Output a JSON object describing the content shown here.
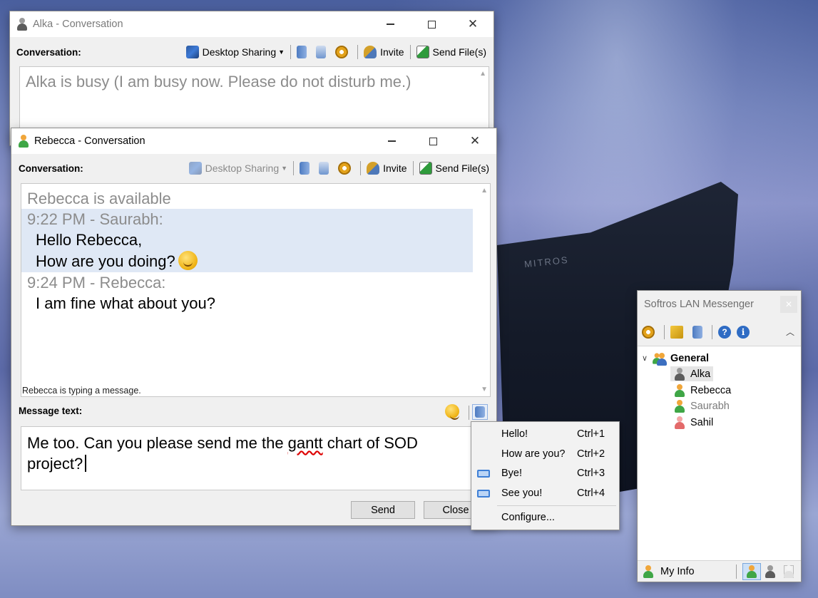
{
  "desktop": {
    "background_text": "MITROS"
  },
  "alka_window": {
    "title": "Alka - Conversation",
    "toolbar": {
      "label": "Conversation:",
      "desktop_sharing": "Desktop Sharing",
      "invite": "Invite",
      "send_files": "Send File(s)"
    },
    "status": "Alka is busy (I am busy now. Please do not disturb me.)"
  },
  "rebecca_window": {
    "title": "Rebecca - Conversation",
    "toolbar": {
      "label": "Conversation:",
      "desktop_sharing": "Desktop Sharing",
      "invite": "Invite",
      "send_files": "Send File(s)"
    },
    "status": "Rebecca is available",
    "messages": [
      {
        "header": "9:22 PM - Saurabh:",
        "lines": [
          "Hello Rebecca,",
          "How are you doing?"
        ],
        "highlighted": true
      },
      {
        "header": "9:24 PM - Rebecca:",
        "lines": [
          "I am fine what about you?"
        ],
        "highlighted": false
      }
    ],
    "typing_indicator": "Rebecca is typing a message.",
    "message_label": "Message text:",
    "input_value_part1": "Me too. Can you please send me the ",
    "input_value_misspelled": "gantt",
    "input_value_part2": " chart of SOD project?",
    "send_button": "Send",
    "close_button": "Close"
  },
  "quick_text_menu": {
    "items": [
      {
        "label": "Hello!",
        "shortcut": "Ctrl+1",
        "icon": null
      },
      {
        "label": "How are you?",
        "shortcut": "Ctrl+2",
        "icon": null
      },
      {
        "label": "Bye!",
        "shortcut": "Ctrl+3",
        "icon": "quick-text-icon"
      },
      {
        "label": "See you!",
        "shortcut": "Ctrl+4",
        "icon": "quick-text-icon"
      }
    ],
    "configure": "Configure..."
  },
  "lan_messenger": {
    "title": "Softros LAN Messenger",
    "group": "General",
    "contacts": [
      {
        "name": "Alka",
        "status": "busy",
        "selected": true
      },
      {
        "name": "Rebecca",
        "status": "available",
        "selected": false
      },
      {
        "name": "Saurabh",
        "status": "available-self",
        "selected": false
      },
      {
        "name": "Sahil",
        "status": "do-not-disturb",
        "selected": false
      }
    ],
    "my_info": "My Info"
  },
  "colors": {
    "highlight_row": "#dfe8f5",
    "status_gray": "#8c8c8c",
    "accent_blue": "#3e7fd6"
  }
}
